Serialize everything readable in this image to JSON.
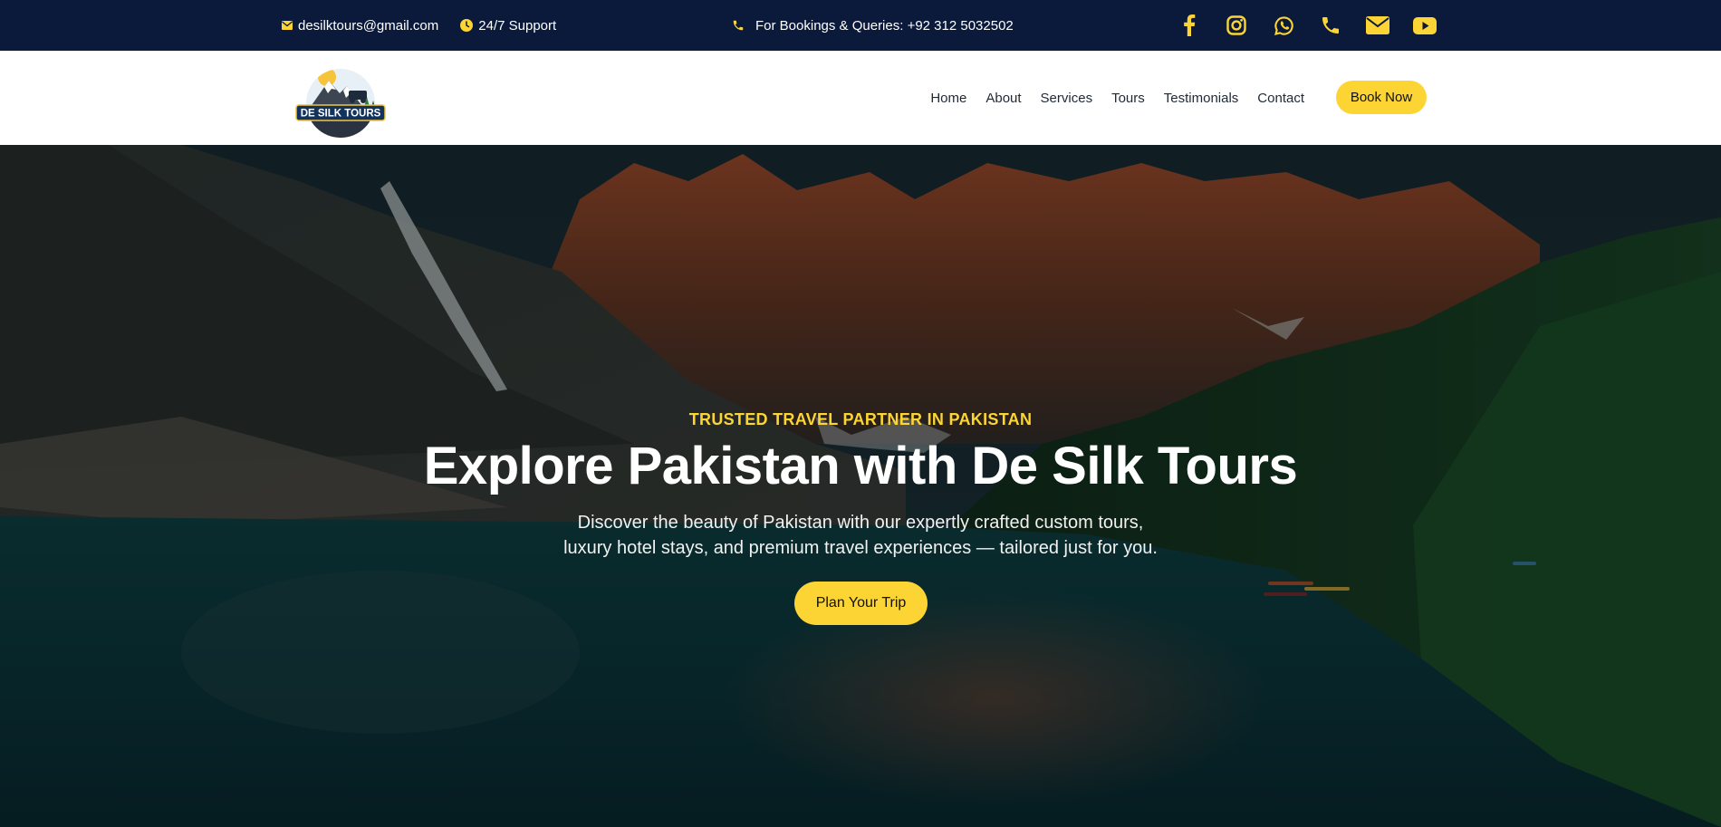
{
  "topbar": {
    "email": "desilktours@gmail.com",
    "support": "24/7 Support",
    "bookings": "For Bookings & Queries: +92 312 5032502",
    "social": [
      "facebook-icon",
      "instagram-icon",
      "whatsapp-icon",
      "phone-icon",
      "mail-icon",
      "youtube-icon"
    ]
  },
  "logo": {
    "text": "DE SILK TOURS"
  },
  "nav": {
    "items": [
      "Home",
      "About",
      "Services",
      "Tours",
      "Testimonials",
      "Contact"
    ],
    "book_label": "Book Now"
  },
  "hero": {
    "eyebrow": "TRUSTED TRAVEL PARTNER IN PAKISTAN",
    "title": "Explore Pakistan with De Silk Tours",
    "subtitle_line1": "Discover the beauty of Pakistan with our expertly crafted custom tours,",
    "subtitle_line2": "luxury hotel stays, and premium travel experiences — tailored just for you.",
    "cta_label": "Plan Your Trip"
  },
  "colors": {
    "navy": "#0b1a3a",
    "accent": "#fcd535",
    "white": "#ffffff"
  }
}
